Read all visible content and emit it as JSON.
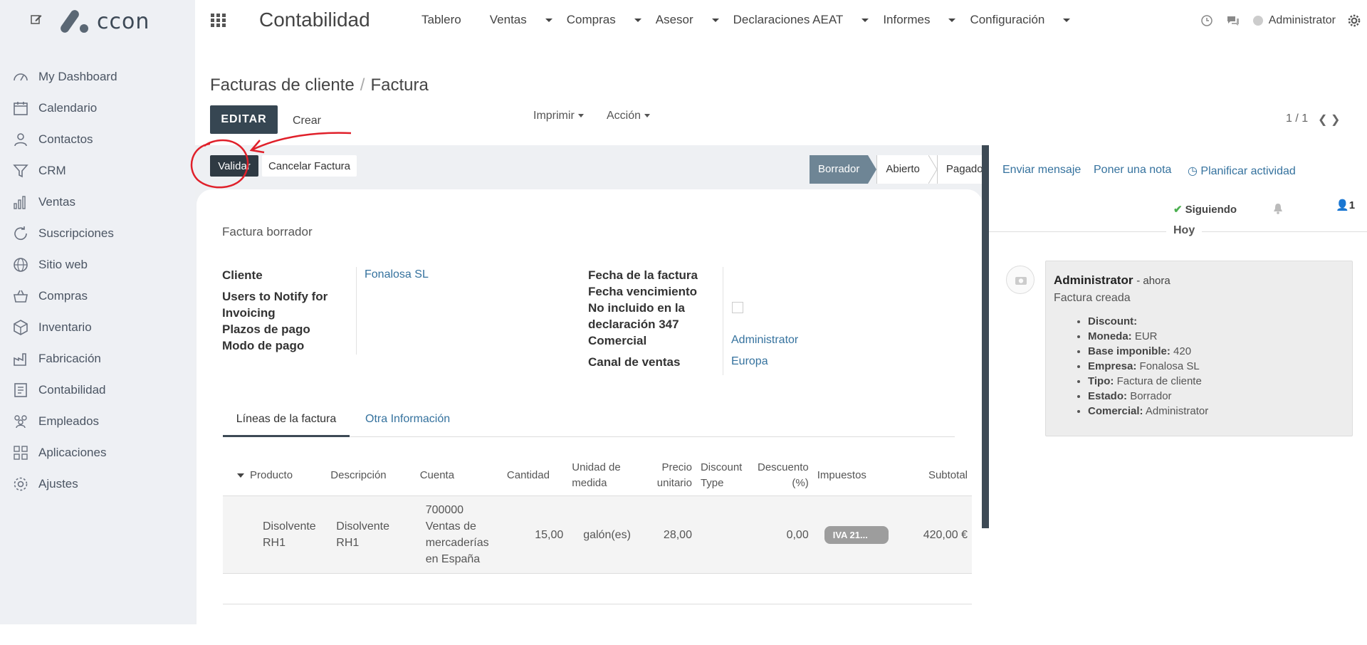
{
  "sidebar": {
    "logo_text": "ccon",
    "items": [
      {
        "label": "My Dashboard",
        "icon": "dashboard-icon"
      },
      {
        "label": "Calendario",
        "icon": "calendar-icon"
      },
      {
        "label": "Contactos",
        "icon": "contacts-icon"
      },
      {
        "label": "CRM",
        "icon": "filter-icon"
      },
      {
        "label": "Ventas",
        "icon": "bar-chart-icon"
      },
      {
        "label": "Suscripciones",
        "icon": "refresh-icon"
      },
      {
        "label": "Sitio web",
        "icon": "globe-icon"
      },
      {
        "label": "Compras",
        "icon": "basket-icon"
      },
      {
        "label": "Inventario",
        "icon": "box-icon"
      },
      {
        "label": "Fabricación",
        "icon": "factory-icon"
      },
      {
        "label": "Contabilidad",
        "icon": "ledger-icon"
      },
      {
        "label": "Empleados",
        "icon": "people-icon"
      },
      {
        "label": "Aplicaciones",
        "icon": "apps-grid-icon"
      },
      {
        "label": "Ajustes",
        "icon": "gear-icon"
      }
    ]
  },
  "topbar": {
    "app_title": "Contabilidad",
    "menu": [
      "Tablero",
      "Ventas",
      "Compras",
      "Asesor",
      "Declaraciones AEAT",
      "Informes",
      "Configuración"
    ],
    "user": "Administrator"
  },
  "control": {
    "breadcrumb_parent": "Facturas de cliente",
    "breadcrumb_current": "Factura",
    "edit_label": "EDITAR",
    "create_label": "Crear",
    "print_label": "Imprimir",
    "action_label": "Acción",
    "pager": "1 / 1"
  },
  "statusbar": {
    "validate_label": "Validar",
    "cancel_label": "Cancelar Factura",
    "stages": [
      "Borrador",
      "Abierto",
      "Pagado"
    ],
    "active_stage": "Borrador"
  },
  "form": {
    "title": "Factura borrador",
    "cliente_label": "Cliente",
    "cliente_value": "Fonalosa SL",
    "notify_label": "Users to Notify for Invoicing",
    "plazos_label": "Plazos de pago",
    "modo_label": "Modo de pago",
    "fecha_factura_label": "Fecha de la factura",
    "fecha_venc_label": "Fecha vencimiento",
    "no_incluido_label": "No incluido en la declaración 347",
    "comercial_label": "Comercial",
    "comercial_value": "Administrator",
    "canal_label": "Canal de ventas",
    "canal_value": "Europa",
    "tabs": [
      "Líneas de la factura",
      "Otra Información"
    ]
  },
  "lines": {
    "headers": [
      "Producto",
      "Descripción",
      "Cuenta",
      "Cantidad",
      "Unidad de medida",
      "Precio unitario",
      "Discount Type",
      "Descuento (%)",
      "Impuestos",
      "Subtotal"
    ],
    "rows": [
      {
        "producto": "Disolvente RH1",
        "descripcion": "Disolvente RH1",
        "cuenta": "700000 Ventas de mercaderías en España",
        "cantidad": "15,00",
        "unidad": "galón(es)",
        "precio": "28,00",
        "discount_type": "",
        "descuento": "0,00",
        "impuestos": "IVA 21...",
        "subtotal": "420,00 €"
      }
    ]
  },
  "chatter": {
    "send_message": "Enviar mensaje",
    "log_note": "Poner una nota",
    "schedule": "Planificar actividad",
    "following": "Siguiendo",
    "followers_count": "1",
    "day_separator": "Hoy",
    "message": {
      "author": "Administrator",
      "time": "- ahora",
      "body": "Factura creada",
      "tracking": [
        {
          "field": "Discount:",
          "value": ""
        },
        {
          "field": "Moneda:",
          "value": "EUR"
        },
        {
          "field": "Base imponible:",
          "value": "420"
        },
        {
          "field": "Empresa:",
          "value": "Fonalosa SL"
        },
        {
          "field": "Tipo:",
          "value": "Factura de cliente"
        },
        {
          "field": "Estado:",
          "value": "Borrador"
        },
        {
          "field": "Comercial:",
          "value": "Administrator"
        }
      ]
    }
  },
  "colors": {
    "sidebar_bg": "#eef0f4",
    "primary_button": "#364652",
    "link": "#35729e",
    "annotation": "#e0202a"
  }
}
